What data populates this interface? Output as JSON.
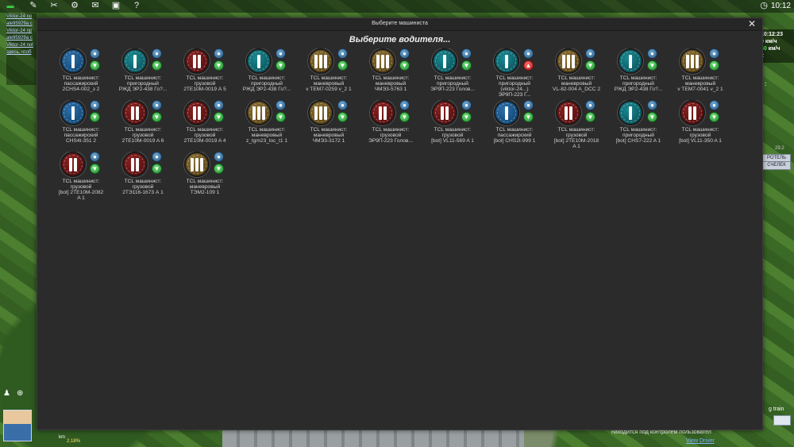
{
  "window": {
    "title": "Выберите машиниста",
    "heading": "Выберите водителя...",
    "close_glyph": "✕"
  },
  "topbar": {
    "icons": [
      "zoom-icon",
      "tools-icon",
      "edit-icon",
      "chat-icon",
      "save-icon",
      "help-icon"
    ],
    "time": "10:12"
  },
  "chat": {
    "lines": [
      "Viktor-24 по",
      "ale95929a с",
      "Viktor-24 пр",
      "ale95929a с",
      "Viktor-24 not",
      "здесь, чтоб"
    ]
  },
  "hud": {
    "time": "10:12:23",
    "speed1": "0 км/ч",
    "speed2_value": "50",
    "speed2_unit": "км/ч",
    "extra": "2",
    "button_top": "РОТЕЛЬ",
    "side_label": ":",
    "side_num": "29.2",
    "side_button": "СЧЕЛЕК"
  },
  "bottom": {
    "km": "km",
    "percent": "2.18%",
    "notice": "находится под контролем пользовател",
    "view_driver": "View Driver",
    "side_note": "g train"
  },
  "drivers": [
    {
      "color": "blue",
      "bars": 1,
      "status": "down",
      "lines": [
        "TCL машинист:",
        "пассажирский",
        "2CHS4-002_з 2"
      ]
    },
    {
      "color": "teal",
      "bars": 1,
      "status": "down",
      "lines": [
        "TCL машинист:",
        "пригородный",
        "РЖД ЭР2-438 Го?..."
      ]
    },
    {
      "color": "red",
      "bars": 2,
      "status": "down",
      "lines": [
        "TCL машинист:",
        "грузовой",
        "2ТЕ10М-0019 А 5"
      ]
    },
    {
      "color": "teal",
      "bars": 1,
      "status": "down",
      "lines": [
        "TCL машинист:",
        "пригородный",
        "РЖД ЭР2-438 Го?..."
      ]
    },
    {
      "color": "olive",
      "bars": 3,
      "status": "down",
      "lines": [
        "TCL машинист:",
        "маневровый",
        "v TEM7-0259 v_2 1"
      ]
    },
    {
      "color": "olive",
      "bars": 3,
      "status": "down",
      "lines": [
        "TCL машинист:",
        "маневровый",
        "ЧМЭ3-5763 1"
      ]
    },
    {
      "color": "teal",
      "bars": 1,
      "status": "down",
      "lines": [
        "TCL машинист:",
        "пригородный",
        "ЭР9П-223 Голов..."
      ]
    },
    {
      "color": "teal",
      "bars": 1,
      "status": "up",
      "lines": [
        "TCL машинист:",
        "пригородный",
        "(viktor-24...)",
        "ЭР9П-223 Г..."
      ]
    },
    {
      "color": "olive",
      "bars": 3,
      "status": "down",
      "lines": [
        "TCL машинист:",
        "маневровый",
        "VL-82-004 A_DCC 2"
      ]
    },
    {
      "color": "teal",
      "bars": 1,
      "status": "down",
      "lines": [
        "TCL машинист:",
        "пригородный",
        "РЖД ЭР2-438 Го?..."
      ]
    },
    {
      "color": "olive",
      "bars": 3,
      "status": "down",
      "lines": [
        "TCL машинист:",
        "маневровый",
        "v TEM7-0041 v_2 1"
      ]
    },
    {
      "color": "blue",
      "bars": 1,
      "status": "down",
      "lines": [
        "TCL машинист:",
        "пассажирский",
        "CHS4t-351 2"
      ]
    },
    {
      "color": "red",
      "bars": 2,
      "status": "down",
      "lines": [
        "TCL машинист:",
        "грузовой",
        "2TE10M-0019 A 6"
      ]
    },
    {
      "color": "red",
      "bars": 2,
      "status": "down",
      "lines": [
        "TCL машинист:",
        "грузовой",
        "2TE10M-0019 A 4"
      ]
    },
    {
      "color": "olive",
      "bars": 3,
      "status": "down",
      "lines": [
        "TCL машинист:",
        "маневровый",
        "z_tgm23_loc_t1 1"
      ]
    },
    {
      "color": "olive",
      "bars": 3,
      "status": "down",
      "lines": [
        "TCL машинист:",
        "маневровый",
        "ЧМЭ3-3172 1"
      ]
    },
    {
      "color": "red",
      "bars": 2,
      "status": "down",
      "lines": [
        "TCL машинист:",
        "грузовой",
        "ЭР9П-223 Голов..."
      ]
    },
    {
      "color": "red",
      "bars": 2,
      "status": "down",
      "lines": [
        "TCL машинист:",
        "грузовой",
        "[bot] VL11-569 A 1"
      ]
    },
    {
      "color": "blue",
      "bars": 1,
      "status": "down",
      "lines": [
        "TCL машинист:",
        "пассажирский",
        "[bot] CHS2t-999 1"
      ]
    },
    {
      "color": "red",
      "bars": 2,
      "status": "down",
      "lines": [
        "TCL машинист:",
        "грузовой",
        "[bot] 2TE10M-2018",
        "A 1"
      ]
    },
    {
      "color": "teal",
      "bars": 1,
      "status": "down",
      "lines": [
        "TCL машинист:",
        "пригородный",
        "[bot] CHS7-222 A 1"
      ]
    },
    {
      "color": "red",
      "bars": 2,
      "status": "down",
      "lines": [
        "TCL машинист:",
        "грузовой",
        "[bot] VL11-350 A 1"
      ]
    },
    {
      "color": "red",
      "bars": 2,
      "status": "down",
      "lines": [
        "TCL машинист:",
        "грузовой",
        "[bot] 2TE10M-2082",
        "A 1"
      ]
    },
    {
      "color": "red",
      "bars": 2,
      "status": "down",
      "lines": [
        "TCL машинист:",
        "грузовой",
        "2ТЭ116-1673 А 1"
      ]
    },
    {
      "color": "olive",
      "bars": 3,
      "status": "down",
      "lines": [
        "TCL машинист:",
        "маневровый",
        "ТЭМ2-109 1"
      ]
    }
  ],
  "colors": {
    "blue": "#124a7a",
    "teal": "#0a5a63",
    "red": "#5a0f0f",
    "olive": "#5c4514",
    "dialog_bg": "#2b2b2b"
  }
}
